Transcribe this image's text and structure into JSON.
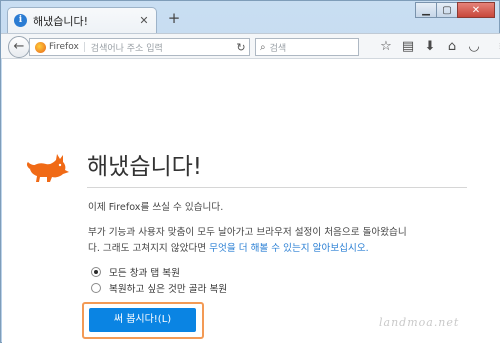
{
  "tab": {
    "icon_glyph": "i",
    "title": "해냈습니다!",
    "close_glyph": "✕"
  },
  "new_tab_glyph": "+",
  "window_controls": {
    "minimize": "▁",
    "maximize": "▢",
    "close": "✕"
  },
  "navbar": {
    "back_glyph": "←",
    "identity_label": "Firefox",
    "url_placeholder": "검색어나 주소 입력",
    "reload_glyph": "↻",
    "search_glyph": "⌕",
    "search_placeholder": "검색",
    "icons": [
      "star-icon",
      "clipboard-icon",
      "download-icon",
      "home-icon",
      "pocket-icon",
      "hamburger-menu-icon"
    ],
    "icon_glyphs": {
      "star": "☆",
      "clipboard": "▤",
      "download": "⬇",
      "home": "⌂",
      "pocket": "◡",
      "menu": "≡"
    }
  },
  "content": {
    "heading": "해냈습니다!",
    "line1": "이제 Firefox를 쓰실 수 있습니다.",
    "line2": "부가 기능과 사용자 맞춤이 모두 날아가고 브라우저 설정이 처음으로 돌아왔습니",
    "line3_prefix": "다. 그래도 고쳐지지 않았다면 ",
    "line3_link": "무엇을 더 해볼 수 있는지 알아보십시오.",
    "radio_options": [
      {
        "label": "모든 창과 탭 복원",
        "checked": true
      },
      {
        "label": "복원하고 싶은 것만 골라 복원",
        "checked": false
      }
    ],
    "primary_button": "써 봅시다!(L)"
  },
  "watermark": "landmoa.net",
  "colors": {
    "accent": "#0a84e3",
    "link": "#2a7fd4",
    "highlight": "#f39a55",
    "fox": "#f06a16"
  }
}
